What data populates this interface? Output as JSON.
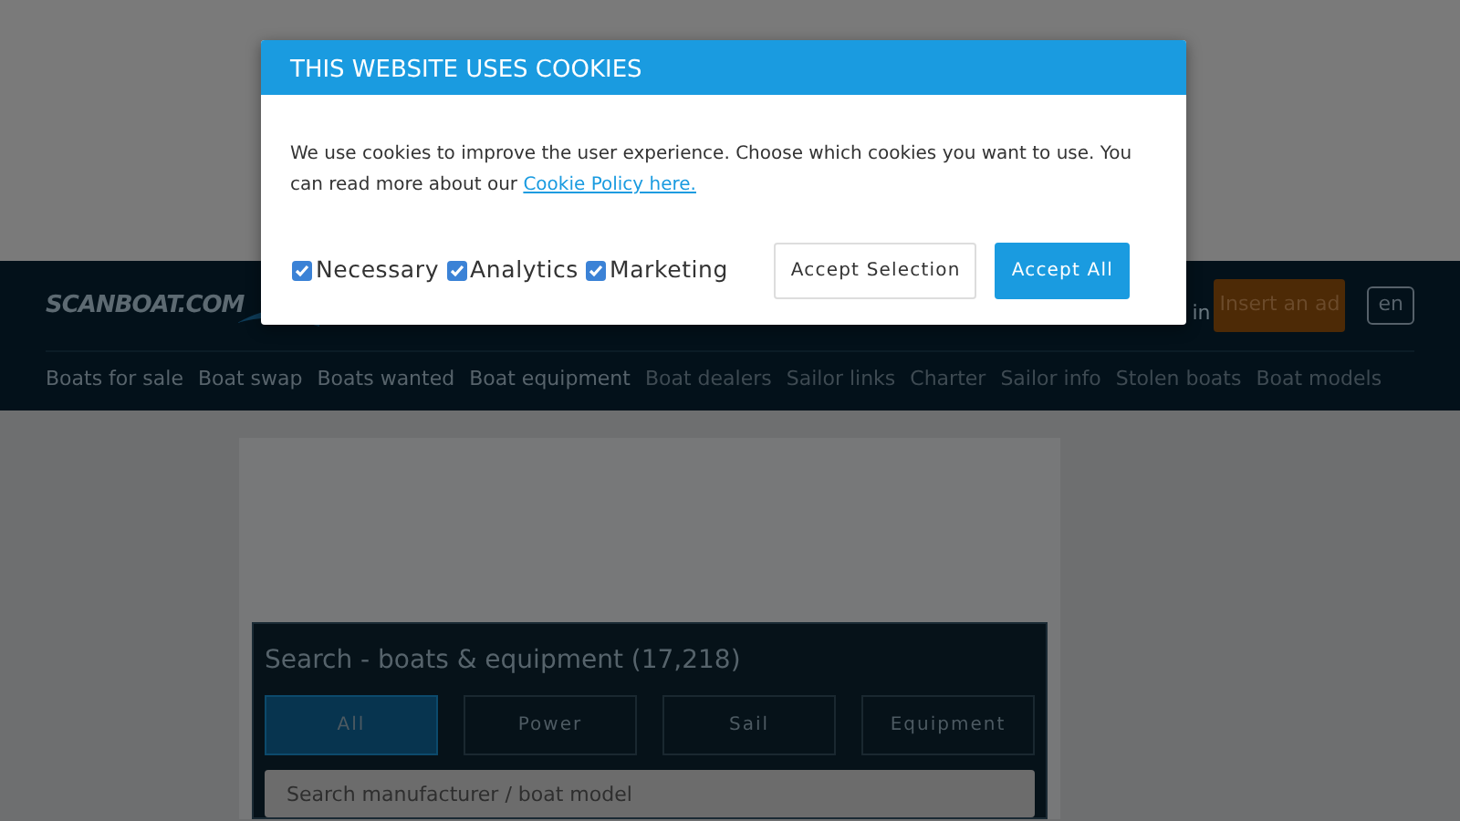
{
  "header": {
    "logo": "SCANBOAT.COM",
    "login_fragment": "in",
    "insert_button": "Insert an ad",
    "language": "en"
  },
  "nav": [
    "Boats for sale",
    "Boat swap",
    "Boats wanted",
    "Boat equipment",
    "Boat dealers",
    "Sailor links",
    "Charter",
    "Sailor info",
    "Stolen boats",
    "Boat models"
  ],
  "search": {
    "title": "Search - boats & equipment (17,218)",
    "tabs": [
      {
        "label": "All",
        "selected": true
      },
      {
        "label": "Power",
        "selected": false
      },
      {
        "label": "Sail",
        "selected": false
      },
      {
        "label": "Equipment",
        "selected": false
      }
    ],
    "placeholder": "Search manufacturer / boat model"
  },
  "cookie_dialog": {
    "title": "THIS WEBSITE USES COOKIES",
    "text": "We use cookies to improve the user experience. Choose which cookies you want to use. You can read more about our ",
    "link": "Cookie Policy here.",
    "options": [
      {
        "label": "Necessary",
        "checked": true
      },
      {
        "label": "Analytics",
        "checked": true
      },
      {
        "label": "Marketing",
        "checked": true
      }
    ],
    "buttons": [
      {
        "label": "Accept Selection",
        "kind": "secondary"
      },
      {
        "label": "Accept All",
        "kind": "primary"
      }
    ]
  }
}
